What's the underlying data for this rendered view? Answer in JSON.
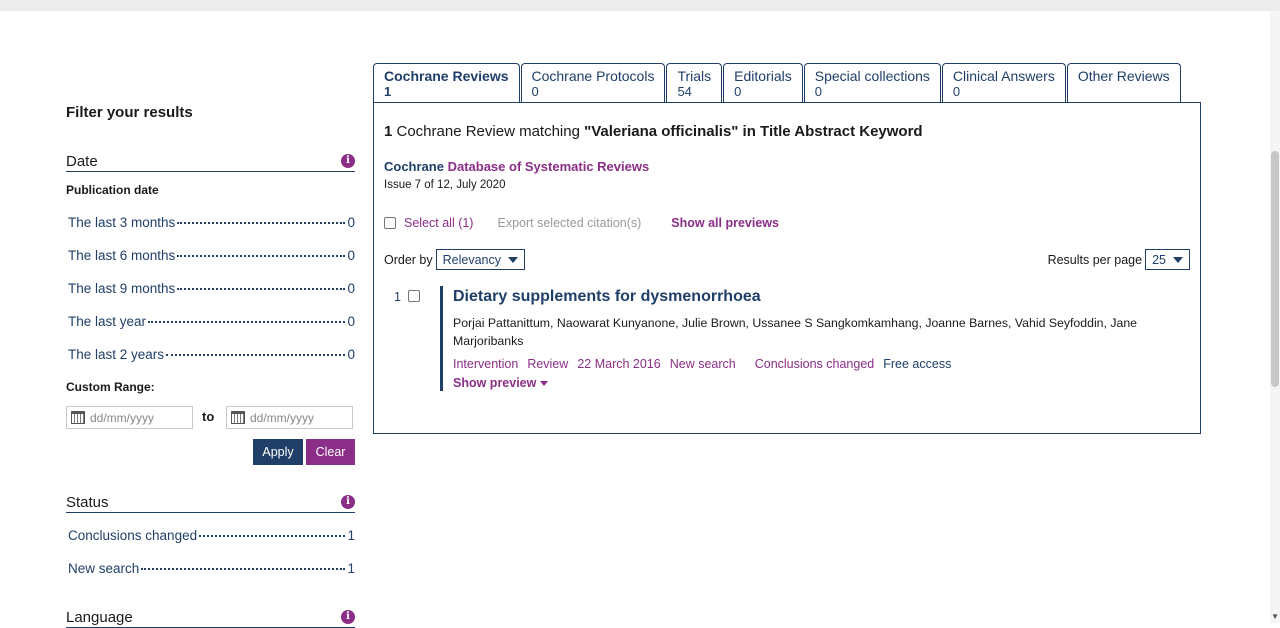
{
  "sidebar": {
    "title": "Filter your results",
    "date": {
      "heading": "Date",
      "publication_date": "Publication date",
      "items": [
        {
          "label": "The last 3 months",
          "count": "0"
        },
        {
          "label": "The last 6 months",
          "count": "0"
        },
        {
          "label": "The last 9 months",
          "count": "0"
        },
        {
          "label": "The last year",
          "count": "0"
        },
        {
          "label": "The last 2 years",
          "count": "0"
        }
      ],
      "custom_range": "Custom Range:",
      "from_placeholder": "dd/mm/yyyy",
      "to_label": "to",
      "to_placeholder": "dd/mm/yyyy",
      "apply": "Apply",
      "clear": "Clear"
    },
    "status": {
      "heading": "Status",
      "items": [
        {
          "label": "Conclusions changed",
          "count": "1"
        },
        {
          "label": "New search",
          "count": "1"
        }
      ]
    },
    "language": {
      "heading": "Language"
    }
  },
  "tabs": [
    {
      "label": "Cochrane Reviews",
      "count": "1"
    },
    {
      "label": "Cochrane Protocols",
      "count": "0"
    },
    {
      "label": "Trials",
      "count": "54"
    },
    {
      "label": "Editorials",
      "count": "0"
    },
    {
      "label": "Special collections",
      "count": "0"
    },
    {
      "label": "Clinical Answers",
      "count": "0"
    },
    {
      "label": "Other Reviews",
      "count": ""
    }
  ],
  "results": {
    "count": "1",
    "matching_text": " Cochrane Review matching ",
    "query": "\"Valeriana officinalis\" in Title Abstract Keyword",
    "db_part1": "Cochrane",
    "db_part2": " Database of Systematic Reviews",
    "issue": "Issue 7 of 12, July 2020",
    "select_all": "Select all (1)",
    "export": "Export selected citation(s)",
    "show_all_previews": "Show all previews",
    "order_by": "Order by",
    "order_value": "Relevancy",
    "results_per_page": "Results per page",
    "per_page_value": "25",
    "items": [
      {
        "number": "1",
        "title": "Dietary supplements for dysmenorrhoea",
        "authors": "Porjai Pattanittum, Naowarat Kunyanone, Julie Brown, Ussanee S Sangkomkamhang, Joanne Barnes, Vahid Seyfoddin, Jane Marjoribanks",
        "type": "Intervention",
        "stage": "Review",
        "date": "22 March 2016",
        "tag1": "New search",
        "tag2": "Conclusions changed",
        "access": "Free access",
        "preview": "Show preview"
      }
    ]
  },
  "colors": {
    "navy": "#1f3f69",
    "purple": "#8a2e87"
  }
}
